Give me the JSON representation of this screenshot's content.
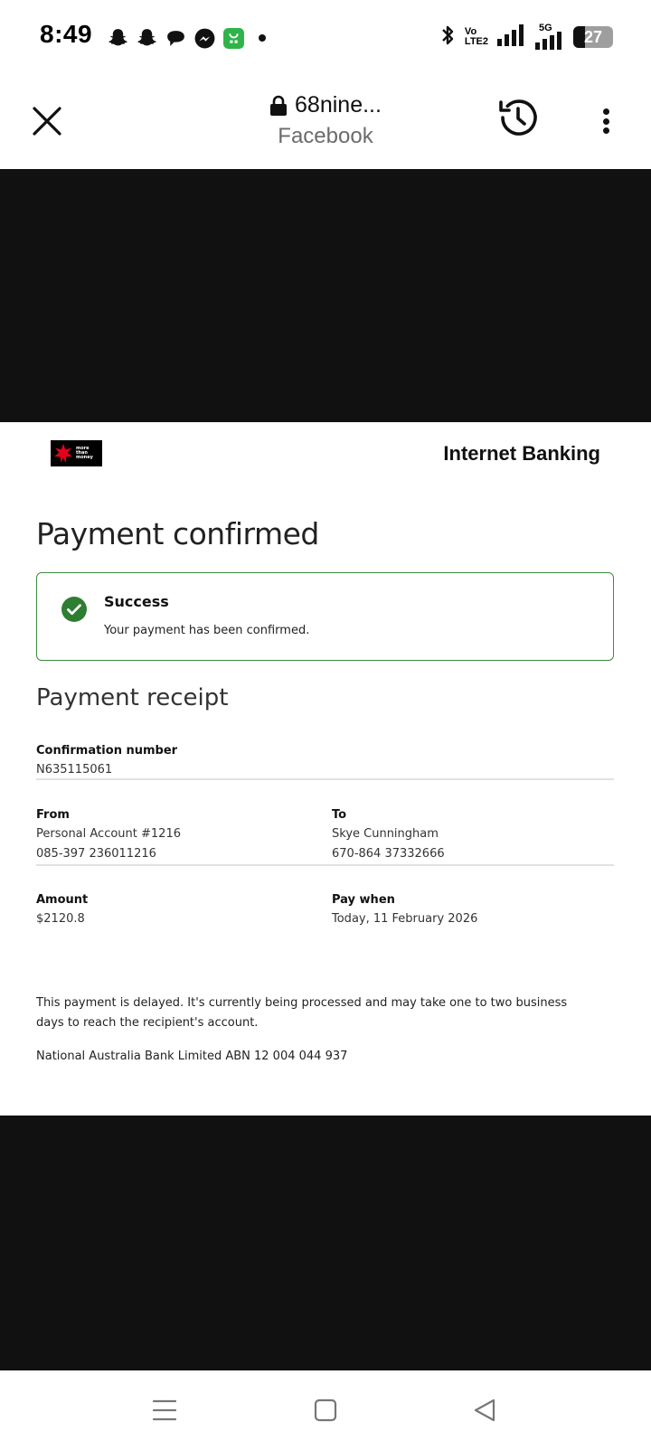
{
  "status_bar": {
    "time": "8:49",
    "notification_icons": [
      "snapchat-icon",
      "snapchat-icon",
      "chat-bubble-icon",
      "messenger-icon",
      "app-store-icon"
    ],
    "network_label": "5G",
    "volte_top": "Vo",
    "volte_bottom": "LTE2",
    "battery": "27"
  },
  "browser": {
    "url": "68nine...",
    "source": "Facebook"
  },
  "page": {
    "header_title": "Internet Banking",
    "logo_text": "more than money",
    "title": "Payment confirmed",
    "alert": {
      "title": "Success",
      "message": "Your payment has been confirmed."
    },
    "receipt_title": "Payment receipt",
    "confirmation": {
      "label": "Confirmation number",
      "value": "N635115061"
    },
    "from": {
      "label": "From",
      "name": "Personal Account #1216",
      "number": "085-397 236011216"
    },
    "to": {
      "label": "To",
      "name": "Skye Cunningham",
      "number": "670-864 37332666"
    },
    "amount": {
      "label": "Amount",
      "value": "$2120.8"
    },
    "pay_when": {
      "label": "Pay when",
      "value": "Today, 11 February 2026"
    },
    "note": "This payment is delayed. It's currently being processed and may take one to two business days to reach the recipient's account.",
    "abn": "National Australia Bank Limited ABN 12 004 044 937"
  },
  "colors": {
    "success_green": "#2e7d32",
    "alert_border": "#3d8b40",
    "brand_red": "#e4001b",
    "letterbox": "#111111"
  }
}
